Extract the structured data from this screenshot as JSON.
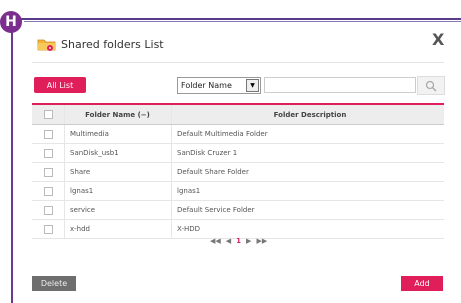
{
  "badge": "H",
  "dialog": {
    "title": "Shared folders List",
    "close": "X"
  },
  "toolbar": {
    "all_list": "All List",
    "filter_value": "Folder Name",
    "search_value": ""
  },
  "table": {
    "headers": {
      "name": "Folder Name (−)",
      "desc": "Folder Description"
    },
    "rows": [
      {
        "name": "Multimedia",
        "desc": "Default Multimedia Folder"
      },
      {
        "name": "SanDisk_usb1",
        "desc": "SanDisk Cruzer 1"
      },
      {
        "name": "Share",
        "desc": "Default Share Folder"
      },
      {
        "name": "lgnas1",
        "desc": "lgnas1"
      },
      {
        "name": "service",
        "desc": "Default Service Folder"
      },
      {
        "name": "x-hdd",
        "desc": "X-HDD"
      }
    ]
  },
  "pager": {
    "first": "◀◀",
    "prev": "◀",
    "page": "1",
    "next": "▶",
    "last": "▶▶"
  },
  "buttons": {
    "delete": "Delete",
    "add": "Add"
  }
}
